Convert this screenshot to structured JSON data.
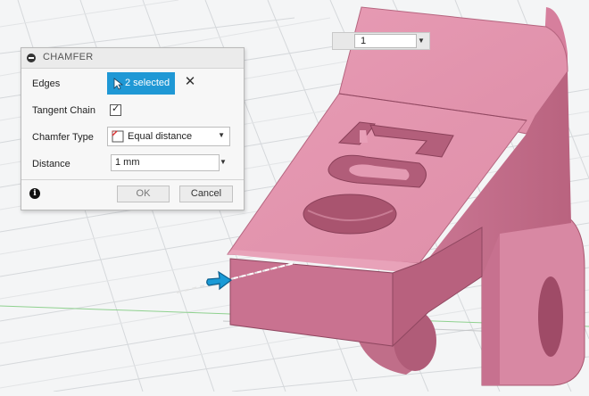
{
  "viewport": {
    "float_input_value": "1"
  },
  "dialog": {
    "title": "CHAMFER",
    "edges_label": "Edges",
    "edges_selection": "2 selected",
    "tangent_chain_label": "Tangent Chain",
    "tangent_chain_checked": true,
    "chamfer_type_label": "Chamfer Type",
    "chamfer_type_value": "Equal distance",
    "distance_label": "Distance",
    "distance_value": "1 mm",
    "ok_label": "OK",
    "cancel_label": "Cancel"
  },
  "icons": {
    "collapse": "minus-circle-icon",
    "selection": "cursor-arrow-icon",
    "clear": "x-icon",
    "chamfer_type": "equal-distance-icon",
    "info": "info-icon",
    "edge_manipulator": "blue-arrow-icon"
  },
  "colors": {
    "model": "#d98aa4",
    "selection_button": "#1f98d5",
    "manipulator": "#1a9ad6",
    "grid": "#d8dadc"
  }
}
